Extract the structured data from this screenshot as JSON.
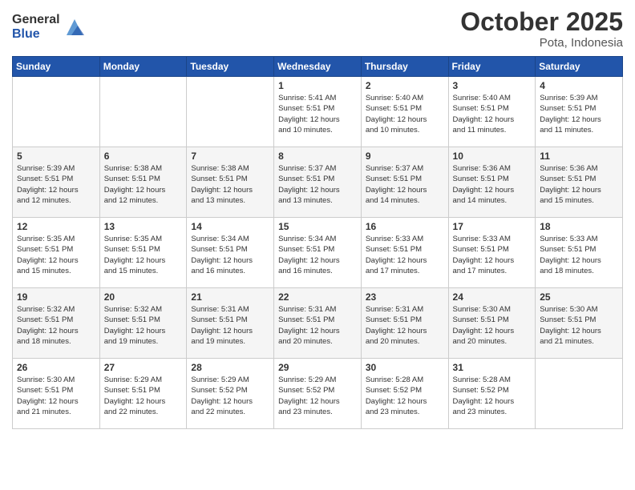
{
  "header": {
    "logo_general": "General",
    "logo_blue": "Blue",
    "month_title": "October 2025",
    "location": "Pota, Indonesia"
  },
  "days_of_week": [
    "Sunday",
    "Monday",
    "Tuesday",
    "Wednesday",
    "Thursday",
    "Friday",
    "Saturday"
  ],
  "weeks": [
    [
      {
        "day": "",
        "info": ""
      },
      {
        "day": "",
        "info": ""
      },
      {
        "day": "",
        "info": ""
      },
      {
        "day": "1",
        "info": "Sunrise: 5:41 AM\nSunset: 5:51 PM\nDaylight: 12 hours\nand 10 minutes."
      },
      {
        "day": "2",
        "info": "Sunrise: 5:40 AM\nSunset: 5:51 PM\nDaylight: 12 hours\nand 10 minutes."
      },
      {
        "day": "3",
        "info": "Sunrise: 5:40 AM\nSunset: 5:51 PM\nDaylight: 12 hours\nand 11 minutes."
      },
      {
        "day": "4",
        "info": "Sunrise: 5:39 AM\nSunset: 5:51 PM\nDaylight: 12 hours\nand 11 minutes."
      }
    ],
    [
      {
        "day": "5",
        "info": "Sunrise: 5:39 AM\nSunset: 5:51 PM\nDaylight: 12 hours\nand 12 minutes."
      },
      {
        "day": "6",
        "info": "Sunrise: 5:38 AM\nSunset: 5:51 PM\nDaylight: 12 hours\nand 12 minutes."
      },
      {
        "day": "7",
        "info": "Sunrise: 5:38 AM\nSunset: 5:51 PM\nDaylight: 12 hours\nand 13 minutes."
      },
      {
        "day": "8",
        "info": "Sunrise: 5:37 AM\nSunset: 5:51 PM\nDaylight: 12 hours\nand 13 minutes."
      },
      {
        "day": "9",
        "info": "Sunrise: 5:37 AM\nSunset: 5:51 PM\nDaylight: 12 hours\nand 14 minutes."
      },
      {
        "day": "10",
        "info": "Sunrise: 5:36 AM\nSunset: 5:51 PM\nDaylight: 12 hours\nand 14 minutes."
      },
      {
        "day": "11",
        "info": "Sunrise: 5:36 AM\nSunset: 5:51 PM\nDaylight: 12 hours\nand 15 minutes."
      }
    ],
    [
      {
        "day": "12",
        "info": "Sunrise: 5:35 AM\nSunset: 5:51 PM\nDaylight: 12 hours\nand 15 minutes."
      },
      {
        "day": "13",
        "info": "Sunrise: 5:35 AM\nSunset: 5:51 PM\nDaylight: 12 hours\nand 15 minutes."
      },
      {
        "day": "14",
        "info": "Sunrise: 5:34 AM\nSunset: 5:51 PM\nDaylight: 12 hours\nand 16 minutes."
      },
      {
        "day": "15",
        "info": "Sunrise: 5:34 AM\nSunset: 5:51 PM\nDaylight: 12 hours\nand 16 minutes."
      },
      {
        "day": "16",
        "info": "Sunrise: 5:33 AM\nSunset: 5:51 PM\nDaylight: 12 hours\nand 17 minutes."
      },
      {
        "day": "17",
        "info": "Sunrise: 5:33 AM\nSunset: 5:51 PM\nDaylight: 12 hours\nand 17 minutes."
      },
      {
        "day": "18",
        "info": "Sunrise: 5:33 AM\nSunset: 5:51 PM\nDaylight: 12 hours\nand 18 minutes."
      }
    ],
    [
      {
        "day": "19",
        "info": "Sunrise: 5:32 AM\nSunset: 5:51 PM\nDaylight: 12 hours\nand 18 minutes."
      },
      {
        "day": "20",
        "info": "Sunrise: 5:32 AM\nSunset: 5:51 PM\nDaylight: 12 hours\nand 19 minutes."
      },
      {
        "day": "21",
        "info": "Sunrise: 5:31 AM\nSunset: 5:51 PM\nDaylight: 12 hours\nand 19 minutes."
      },
      {
        "day": "22",
        "info": "Sunrise: 5:31 AM\nSunset: 5:51 PM\nDaylight: 12 hours\nand 20 minutes."
      },
      {
        "day": "23",
        "info": "Sunrise: 5:31 AM\nSunset: 5:51 PM\nDaylight: 12 hours\nand 20 minutes."
      },
      {
        "day": "24",
        "info": "Sunrise: 5:30 AM\nSunset: 5:51 PM\nDaylight: 12 hours\nand 20 minutes."
      },
      {
        "day": "25",
        "info": "Sunrise: 5:30 AM\nSunset: 5:51 PM\nDaylight: 12 hours\nand 21 minutes."
      }
    ],
    [
      {
        "day": "26",
        "info": "Sunrise: 5:30 AM\nSunset: 5:51 PM\nDaylight: 12 hours\nand 21 minutes."
      },
      {
        "day": "27",
        "info": "Sunrise: 5:29 AM\nSunset: 5:51 PM\nDaylight: 12 hours\nand 22 minutes."
      },
      {
        "day": "28",
        "info": "Sunrise: 5:29 AM\nSunset: 5:52 PM\nDaylight: 12 hours\nand 22 minutes."
      },
      {
        "day": "29",
        "info": "Sunrise: 5:29 AM\nSunset: 5:52 PM\nDaylight: 12 hours\nand 23 minutes."
      },
      {
        "day": "30",
        "info": "Sunrise: 5:28 AM\nSunset: 5:52 PM\nDaylight: 12 hours\nand 23 minutes."
      },
      {
        "day": "31",
        "info": "Sunrise: 5:28 AM\nSunset: 5:52 PM\nDaylight: 12 hours\nand 23 minutes."
      },
      {
        "day": "",
        "info": ""
      }
    ]
  ]
}
